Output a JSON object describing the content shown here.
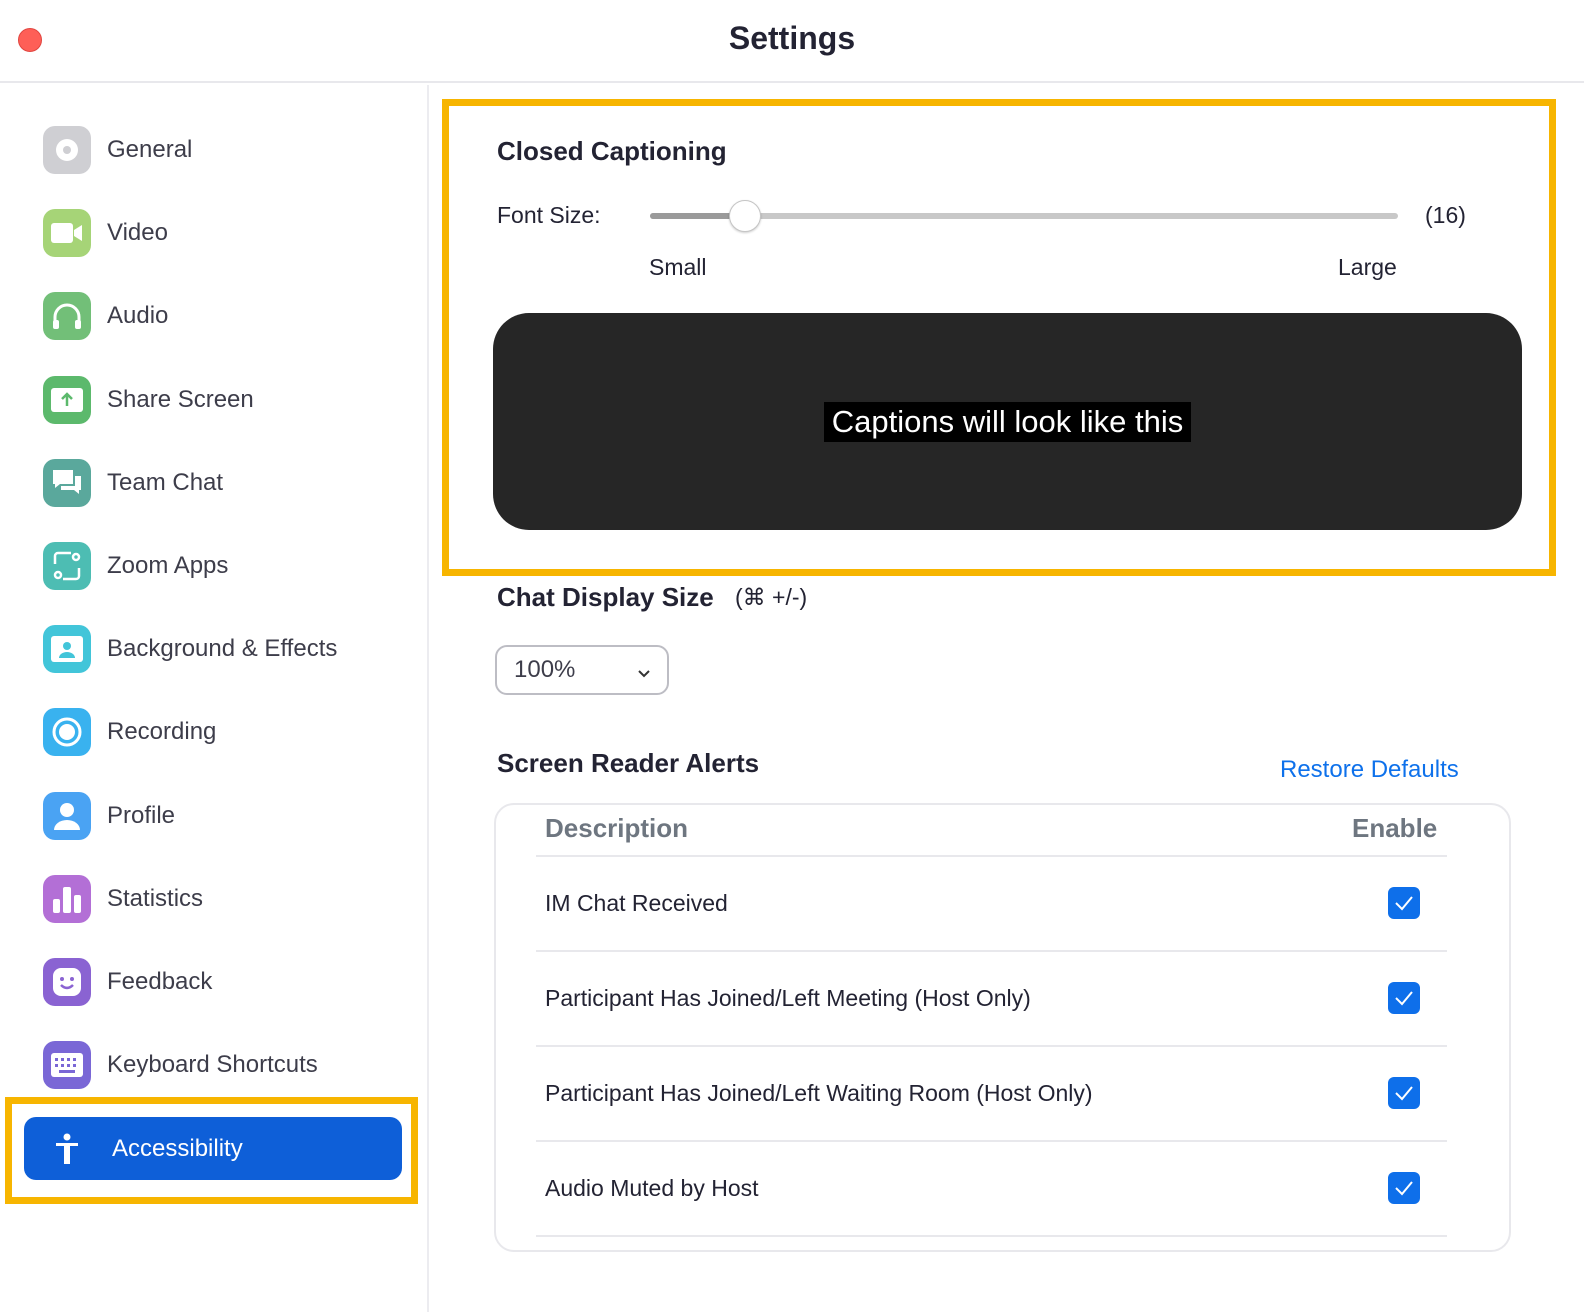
{
  "window": {
    "title": "Settings"
  },
  "sidebar": {
    "items": [
      {
        "label": "General",
        "icon": "gear-icon",
        "color": "#cfcfd3"
      },
      {
        "label": "Video",
        "icon": "video-camera-icon",
        "color": "#a6d477"
      },
      {
        "label": "Audio",
        "icon": "headphones-icon",
        "color": "#72bf78"
      },
      {
        "label": "Share Screen",
        "icon": "share-screen-icon",
        "color": "#5cb96c"
      },
      {
        "label": "Team Chat",
        "icon": "chat-bubbles-icon",
        "color": "#5aa89c"
      },
      {
        "label": "Zoom Apps",
        "icon": "apps-icon",
        "color": "#4dbdb3"
      },
      {
        "label": "Background & Effects",
        "icon": "background-icon",
        "color": "#42c5d9"
      },
      {
        "label": "Recording",
        "icon": "record-icon",
        "color": "#39b2ef"
      },
      {
        "label": "Profile",
        "icon": "person-icon",
        "color": "#4aa3f3"
      },
      {
        "label": "Statistics",
        "icon": "bar-chart-icon",
        "color": "#b36fd6"
      },
      {
        "label": "Feedback",
        "icon": "smiley-icon",
        "color": "#8a63d2"
      },
      {
        "label": "Keyboard Shortcuts",
        "icon": "keyboard-icon",
        "color": "#7a67d6"
      }
    ],
    "active": {
      "label": "Accessibility",
      "icon": "accessibility-icon",
      "color": "#0e5fd8"
    }
  },
  "captioning": {
    "heading": "Closed Captioning",
    "font_size_label": "Font Size:",
    "font_size_value": "(16)",
    "slider_fraction": 0.127,
    "min_label": "Small",
    "max_label": "Large",
    "preview_text": "Captions will look like this"
  },
  "chat_display": {
    "heading": "Chat Display Size",
    "shortcut": "(⌘ +/-)",
    "selected": "100%"
  },
  "screen_reader": {
    "heading": "Screen Reader Alerts",
    "restore_label": "Restore Defaults",
    "columns": [
      "Description",
      "Enable"
    ],
    "rows": [
      {
        "description": "IM Chat Received",
        "enabled": true
      },
      {
        "description": "Participant Has Joined/Left Meeting (Host Only)",
        "enabled": true
      },
      {
        "description": "Participant Has Joined/Left Waiting Room (Host Only)",
        "enabled": true
      },
      {
        "description": "Audio Muted by Host",
        "enabled": true
      }
    ]
  },
  "colors": {
    "accent": "#0e71eb",
    "highlight": "#f7b500"
  }
}
